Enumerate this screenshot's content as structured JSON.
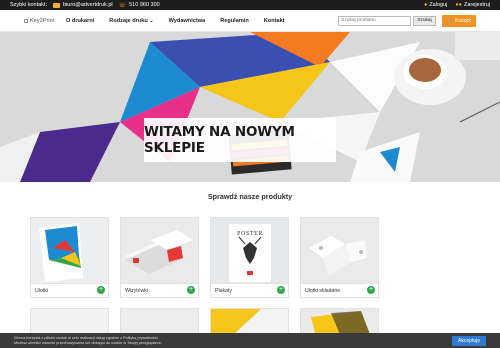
{
  "topbar": {
    "contact_label": "Szybki kontakt:",
    "email": "biuro@advertdruk.pl",
    "phone": "510 960 300",
    "login": "Zaloguj",
    "register": "Zarejestruj"
  },
  "nav": {
    "logo_alt": "Key2Print",
    "items": [
      "O drukarni",
      "Rodzaje druku",
      "Wydawnictwa",
      "Regulamin",
      "Kontakt"
    ],
    "search_placeholder": "Szukaj produktu",
    "search_button": "Szukaj",
    "cart": "Koszyk"
  },
  "hero": {
    "title": "WITAMY NA NOWYM SKLEPIE"
  },
  "products": {
    "title": "Sprawdź nasze produkty",
    "items": [
      {
        "label": "Ulotki"
      },
      {
        "label": "Wizytówki"
      },
      {
        "label": "Plakaty"
      },
      {
        "label": "Ulotki składane"
      }
    ],
    "poster_text": "POSTER"
  },
  "cookie": {
    "line1": "Strona korzysta z plików cookie w celu realizacji usług zgodnie z Polityką prywatności.",
    "line2": "Możesz określić warunki przechowywania lub dostępu do cookie w Twojej przeglądarce.",
    "accept": "Akceptuję"
  },
  "colors": {
    "accent": "#f39221",
    "topbar": "#1d1d1d",
    "plus": "#2fa74a",
    "accept": "#2e7bd1"
  }
}
